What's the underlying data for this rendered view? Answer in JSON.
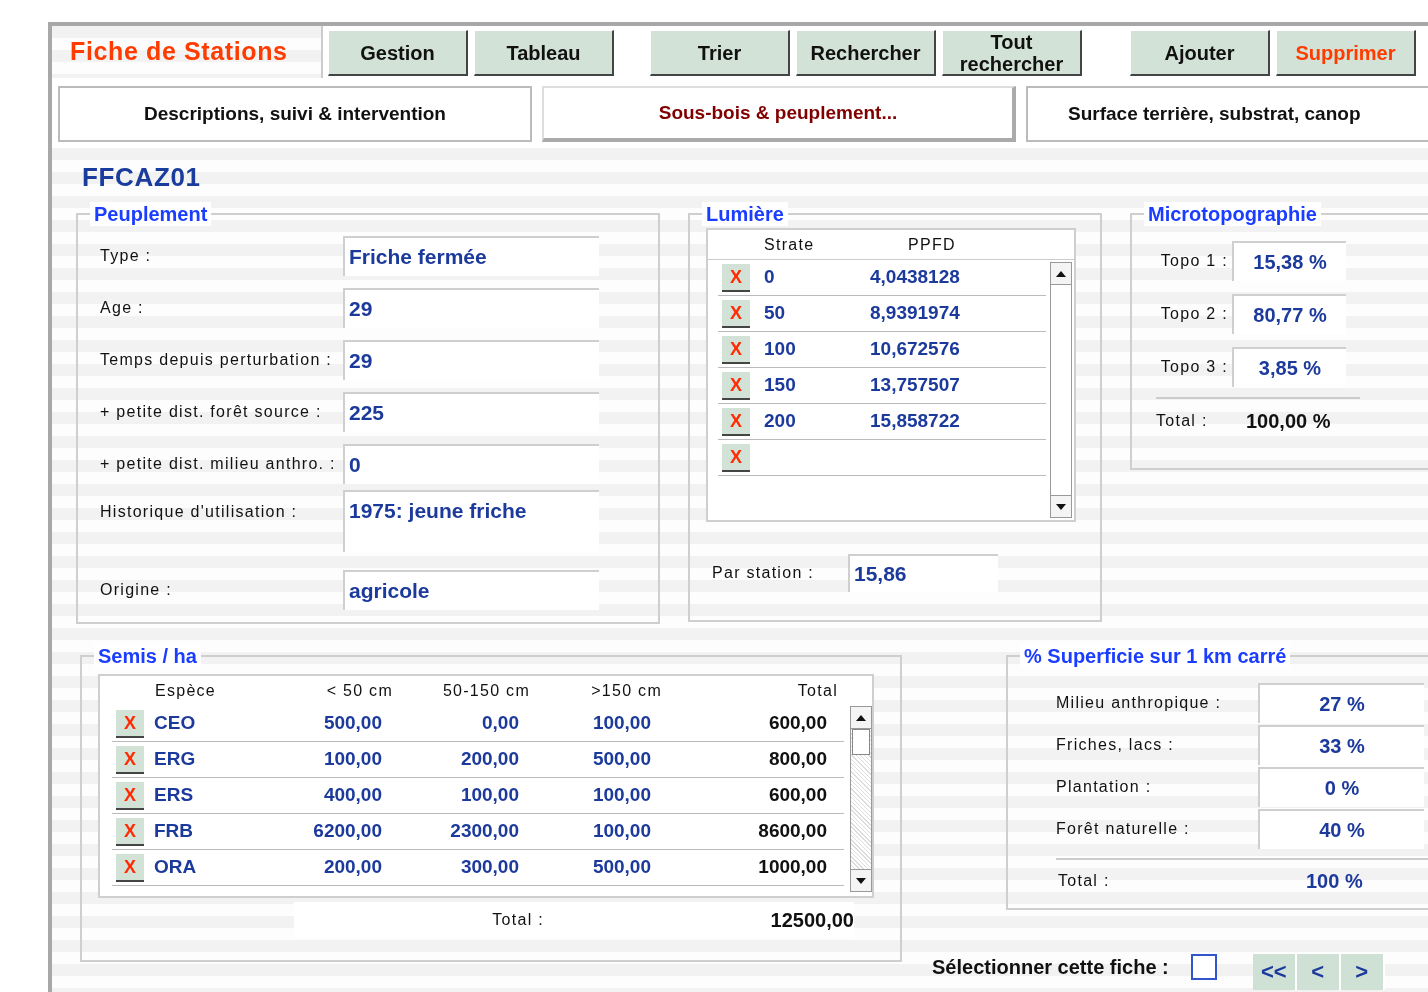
{
  "toolbar": {
    "title": "Fiche de Stations",
    "button_groups": [
      [
        {
          "label": "Gestion",
          "kind": "normal"
        },
        {
          "label": "Tableau",
          "kind": "normal"
        }
      ],
      [
        {
          "label": "Trier",
          "kind": "normal"
        },
        {
          "label": "Rechercher",
          "kind": "normal"
        },
        {
          "label": "Tout rechercher",
          "kind": "normal"
        }
      ],
      [
        {
          "label": "Ajouter",
          "kind": "normal"
        },
        {
          "label": "Supprimer",
          "kind": "danger"
        }
      ]
    ]
  },
  "tabs": [
    {
      "label": "Descriptions, suivi & intervention",
      "selected": false
    },
    {
      "label": "Sous-bois & peuplement...",
      "selected": true
    },
    {
      "label": "Surface terrière, substrat, canop",
      "selected": false
    }
  ],
  "record_id": "FFCAZ01",
  "peuplement": {
    "title": "Peuplement",
    "fields": [
      {
        "label": "Type :",
        "value": "Friche fermée",
        "kind": "text"
      },
      {
        "label": "Age :",
        "value": "29",
        "kind": "text"
      },
      {
        "label": "Temps depuis perturbation :",
        "value": "29",
        "kind": "text"
      },
      {
        "label": "+ petite dist. forêt source :",
        "value": "225",
        "kind": "text"
      },
      {
        "label": "+ petite dist. milieu anthro. :",
        "value": "0",
        "kind": "text"
      },
      {
        "label": "Historique d'utilisation :",
        "value": "1975: jeune friche",
        "kind": "memo"
      },
      {
        "label": "Origine :",
        "value": "agricole",
        "kind": "text"
      }
    ]
  },
  "lumiere": {
    "title": "Lumière",
    "columns": [
      "Strate",
      "PPFD"
    ],
    "rows": [
      {
        "kind": "data",
        "delete_label": "X",
        "strate": "0",
        "ppfd": "4,0438128"
      },
      {
        "kind": "data",
        "delete_label": "X",
        "strate": "50",
        "ppfd": "8,9391974"
      },
      {
        "kind": "data",
        "delete_label": "X",
        "strate": "100",
        "ppfd": "10,672576"
      },
      {
        "kind": "data",
        "delete_label": "X",
        "strate": "150",
        "ppfd": "13,757507"
      },
      {
        "kind": "data",
        "delete_label": "X",
        "strate": "200",
        "ppfd": "15,858722"
      },
      {
        "kind": "new",
        "delete_label": "X"
      }
    ],
    "per_station": {
      "label": "Par station :",
      "value": "15,86"
    }
  },
  "microtopographie": {
    "title": "Microtopographie",
    "rows": [
      {
        "label": "Topo 1 :",
        "value": "15,38 %"
      },
      {
        "label": "Topo 2 :",
        "value": "80,77 %"
      },
      {
        "label": "Topo 3 :",
        "value": "3,85 %"
      }
    ],
    "total": {
      "label": "Total :",
      "value": "100,00 %"
    }
  },
  "semis": {
    "title": "Semis / ha",
    "columns": [
      "Espèce",
      "< 50 cm",
      "50-150 cm",
      ">150 cm",
      "Total"
    ],
    "rows": [
      {
        "delete_label": "X",
        "species": "CEO",
        "lt50": "500,00",
        "mid": "0,00",
        "gt150": "100,00",
        "total": "600,00"
      },
      {
        "delete_label": "X",
        "species": "ERG",
        "lt50": "100,00",
        "mid": "200,00",
        "gt150": "500,00",
        "total": "800,00"
      },
      {
        "delete_label": "X",
        "species": "ERS",
        "lt50": "400,00",
        "mid": "100,00",
        "gt150": "100,00",
        "total": "600,00"
      },
      {
        "delete_label": "X",
        "species": "FRB",
        "lt50": "6200,00",
        "mid": "2300,00",
        "gt150": "100,00",
        "total": "8600,00"
      },
      {
        "delete_label": "X",
        "species": "ORA",
        "lt50": "200,00",
        "mid": "300,00",
        "gt150": "500,00",
        "total": "1000,00"
      }
    ],
    "total": {
      "label": "Total :",
      "value": "12500,00"
    }
  },
  "superficie": {
    "title": "% Superficie sur 1 km carré",
    "rows": [
      {
        "label": "Milieu anthropique :",
        "value": "27 %"
      },
      {
        "label": "Friches, lacs :",
        "value": "33 %"
      },
      {
        "label": "Plantation :",
        "value": "0 %"
      },
      {
        "label": "Forêt naturelle :",
        "value": "40 %"
      }
    ],
    "total": {
      "label": "Total :",
      "value": "100 %"
    }
  },
  "selection": {
    "label": "Sélectionner cette fiche :",
    "checked": false
  },
  "navigation": [
    "<<",
    "<",
    ">"
  ]
}
